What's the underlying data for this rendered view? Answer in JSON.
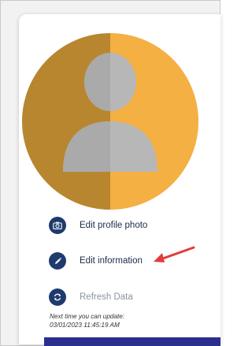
{
  "profile": {
    "avatar_colors": {
      "left": "#b8862e",
      "right": "#f4b042",
      "silhouette": "#b7b7b7"
    }
  },
  "actions": [
    {
      "label": "Edit profile photo",
      "icon": "camera-icon",
      "enabled": true
    },
    {
      "label": "Edit information",
      "icon": "pencil-icon",
      "enabled": true
    },
    {
      "label": "Refresh Data",
      "icon": "refresh-icon",
      "enabled": false
    }
  ],
  "update_notice": {
    "label": "Next time you can update:",
    "timestamp": "03/01/2023 11:45:19 AM"
  },
  "colors": {
    "accent": "#1f3a6e",
    "annotation_arrow": "#e23b3b",
    "bottom_bar": "#2b2f8f"
  }
}
